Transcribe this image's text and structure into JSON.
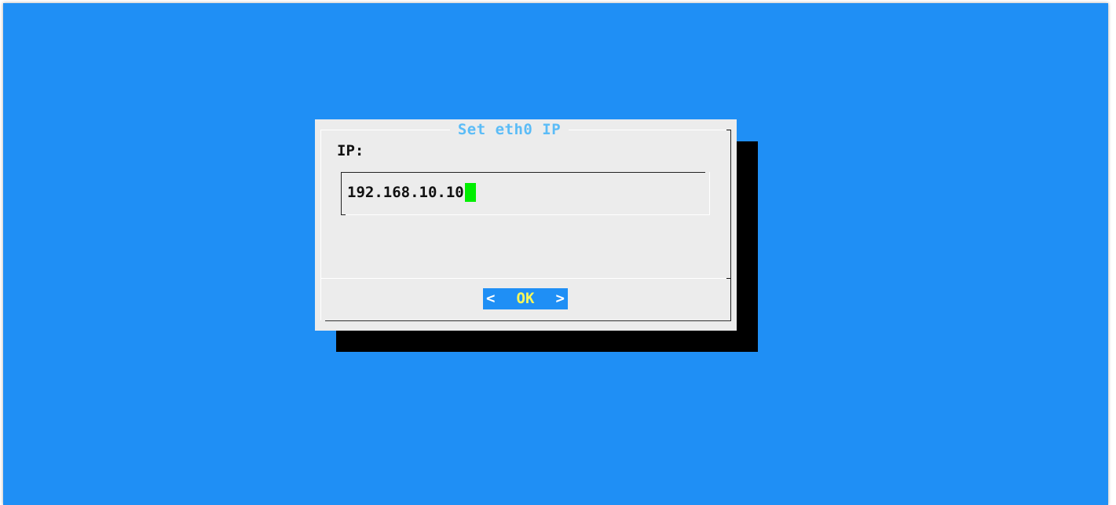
{
  "dialog": {
    "title": "Set eth0 IP",
    "field_label": "IP:",
    "input": {
      "value": "192.168.10.10"
    },
    "ok_button": {
      "left_bracket": "<",
      "label": "OK",
      "right_bracket": ">"
    }
  },
  "colors": {
    "background": "#1f8ff5",
    "dialog": "#ececec",
    "title": "#5bbcf7",
    "cursor": "#00ef00",
    "ok_label": "#f7f75a",
    "shadow": "#000000"
  }
}
